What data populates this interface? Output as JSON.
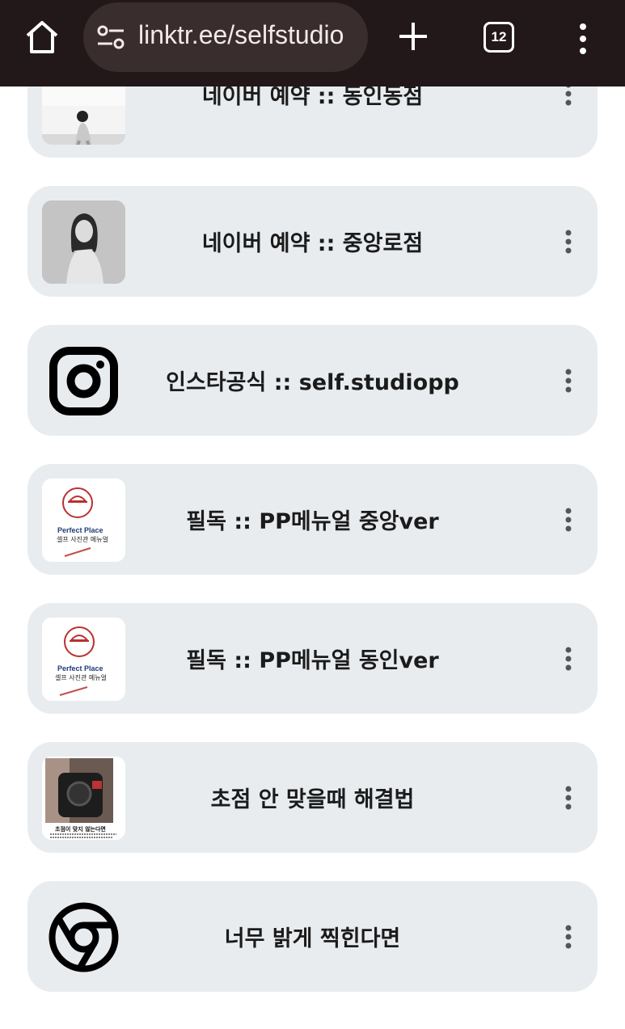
{
  "browser": {
    "url": "linktr.ee/selfstudio",
    "tab_count": "12"
  },
  "links": [
    {
      "title": "네이버 예약 :: 동인동점",
      "thumbnail": "woman-sitting-photo"
    },
    {
      "title": "네이버 예약 :: 중앙로점",
      "thumbnail": "woman-portrait-photo"
    },
    {
      "title": "인스타공식 :: self.studiopp",
      "thumbnail": "instagram-icon"
    },
    {
      "title": "필독 :: PP메뉴얼 중앙ver",
      "thumbnail": "perfect-place-manual",
      "thumb_text": {
        "brand": "Perfect Place",
        "sub": "셀프 사진관 메뉴얼"
      }
    },
    {
      "title": "필독 :: PP메뉴얼 동인ver",
      "thumbnail": "perfect-place-manual",
      "thumb_text": {
        "brand": "Perfect Place",
        "sub": "셀프 사진관 메뉴얼"
      }
    },
    {
      "title": "초점 안 맞을때 해결법",
      "thumbnail": "camera-photo",
      "thumb_text": {
        "caption": "초점이 맞지 않는다면"
      }
    },
    {
      "title": "너무 밝게 찍힌다면",
      "thumbnail": "chrome-icon"
    }
  ]
}
